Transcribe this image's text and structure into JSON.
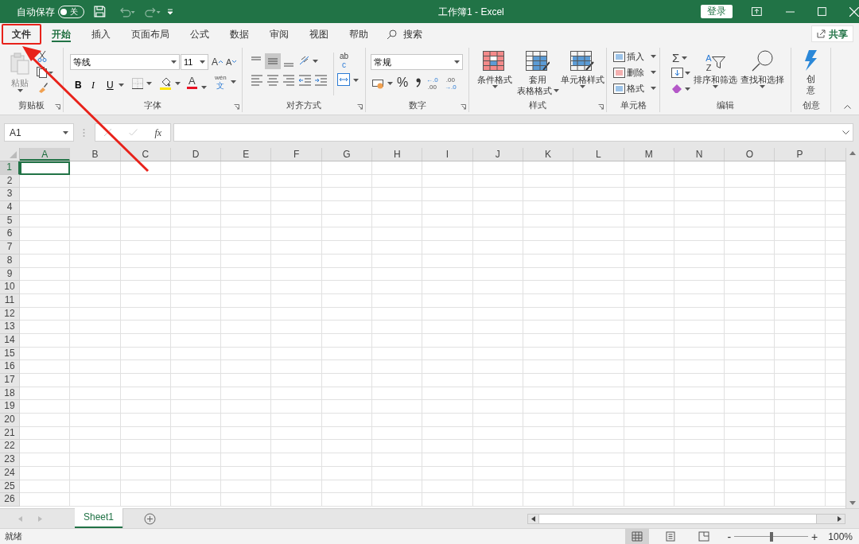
{
  "title_bar": {
    "autosave_label": "自动保存",
    "autosave": {
      "on": false,
      "label": "关"
    },
    "title": "工作簿1 - Excel",
    "sign_in": "登录"
  },
  "tabs": [
    {
      "label": "文件",
      "selected": false,
      "highlighted": true
    },
    {
      "label": "开始",
      "selected": true,
      "highlighted": false
    },
    {
      "label": "插入",
      "selected": false,
      "highlighted": false
    },
    {
      "label": "页面布局",
      "selected": false,
      "highlighted": false
    },
    {
      "label": "公式",
      "selected": false,
      "highlighted": false
    },
    {
      "label": "数据",
      "selected": false,
      "highlighted": false
    },
    {
      "label": "审阅",
      "selected": false,
      "highlighted": false
    },
    {
      "label": "视图",
      "selected": false,
      "highlighted": false
    },
    {
      "label": "帮助",
      "selected": false,
      "highlighted": false
    }
  ],
  "search": "搜索",
  "share": "共享",
  "ribbon": {
    "clipboard": {
      "paste": "粘贴",
      "label": "剪贴板"
    },
    "font": {
      "name": "等线",
      "size": "11",
      "grow": "A",
      "shrink": "A",
      "bold": "B",
      "italic": "I",
      "underline": "U",
      "font_color": "A",
      "phonetic_top": "wén",
      "phonetic_bottom": "文",
      "label": "字体"
    },
    "alignment": {
      "wrap_top": "ab",
      "wrap_bottom": "c",
      "label": "对齐方式"
    },
    "number": {
      "format": "常规",
      "percent": "%",
      "increase_decimal": {
        "top": "←.0",
        "bottom": ".00"
      },
      "decrease_decimal": {
        "top": ".00",
        "bottom": "→.0"
      },
      "label": "数字"
    },
    "styles": {
      "conditional": "条件格式",
      "table_top": "套用",
      "table_bottom": "表格格式",
      "cell_styles": "单元格样式",
      "label": "样式"
    },
    "cells": {
      "insert": "插入",
      "delete": "删除",
      "format": "格式",
      "label": "单元格"
    },
    "editing": {
      "sum": "Σ",
      "sort_letters": [
        "A",
        "Z"
      ],
      "sort_filter": "排序和筛选",
      "find_select": "查找和选择",
      "label": "编辑"
    },
    "ideas": {
      "button": "创意",
      "label": "创意"
    }
  },
  "formula_bar": {
    "name_box": "A1",
    "fx": "fx"
  },
  "columns": [
    {
      "label": "A",
      "selected": true
    },
    {
      "label": "B",
      "selected": false
    },
    {
      "label": "C",
      "selected": false
    },
    {
      "label": "D",
      "selected": false
    },
    {
      "label": "E",
      "selected": false
    },
    {
      "label": "F",
      "selected": false
    },
    {
      "label": "G",
      "selected": false
    },
    {
      "label": "H",
      "selected": false
    },
    {
      "label": "I",
      "selected": false
    },
    {
      "label": "J",
      "selected": false
    },
    {
      "label": "K",
      "selected": false
    },
    {
      "label": "L",
      "selected": false
    },
    {
      "label": "M",
      "selected": false
    },
    {
      "label": "N",
      "selected": false
    },
    {
      "label": "O",
      "selected": false
    },
    {
      "label": "P",
      "selected": false
    }
  ],
  "rows": [
    {
      "label": "1",
      "selected": true
    },
    {
      "label": "2",
      "selected": false
    },
    {
      "label": "3",
      "selected": false
    },
    {
      "label": "4",
      "selected": false
    },
    {
      "label": "5",
      "selected": false
    },
    {
      "label": "6",
      "selected": false
    },
    {
      "label": "7",
      "selected": false
    },
    {
      "label": "8",
      "selected": false
    },
    {
      "label": "9",
      "selected": false
    },
    {
      "label": "10",
      "selected": false
    },
    {
      "label": "11",
      "selected": false
    },
    {
      "label": "12",
      "selected": false
    },
    {
      "label": "13",
      "selected": false
    },
    {
      "label": "14",
      "selected": false
    },
    {
      "label": "15",
      "selected": false
    },
    {
      "label": "16",
      "selected": false
    },
    {
      "label": "17",
      "selected": false
    },
    {
      "label": "18",
      "selected": false
    },
    {
      "label": "19",
      "selected": false
    },
    {
      "label": "20",
      "selected": false
    },
    {
      "label": "21",
      "selected": false
    },
    {
      "label": "22",
      "selected": false
    },
    {
      "label": "23",
      "selected": false
    },
    {
      "label": "24",
      "selected": false
    },
    {
      "label": "25",
      "selected": false
    },
    {
      "label": "26",
      "selected": false
    }
  ],
  "sheets": [
    {
      "name": "Sheet1",
      "selected": true
    }
  ],
  "status_bar": {
    "status": "就绪",
    "views": [
      {
        "kind": "normal",
        "selected": true
      },
      {
        "kind": "page-layout",
        "selected": false
      },
      {
        "kind": "page-break",
        "selected": false
      }
    ],
    "zoom_out": "-",
    "zoom_in": "+",
    "zoom": {
      "level": 0.5
    },
    "zoom_text": "100%"
  }
}
